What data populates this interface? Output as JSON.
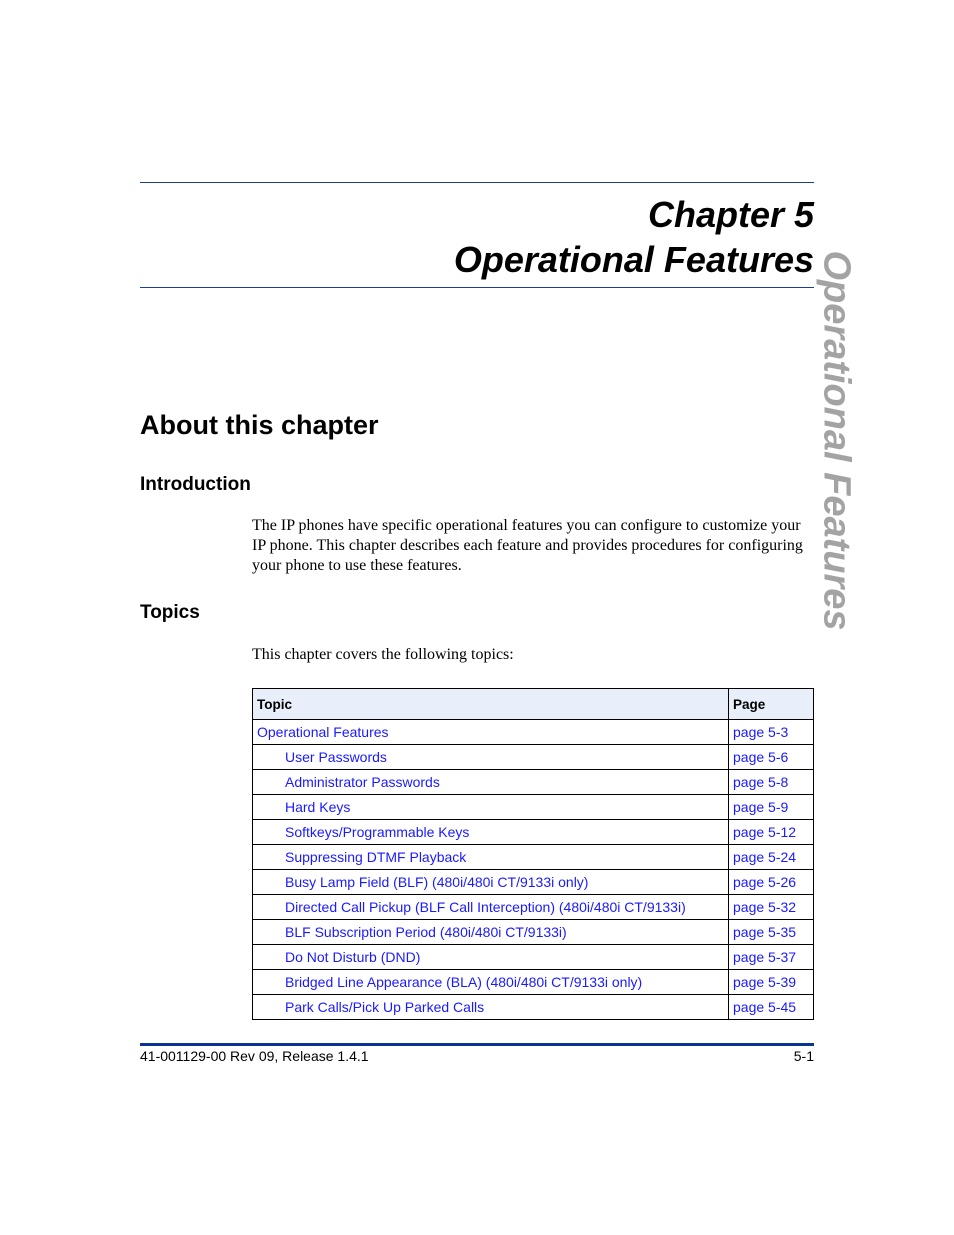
{
  "header": {
    "chapter_line": "Chapter 5",
    "title_line": "Operational Features",
    "side_tab": "Operational Features"
  },
  "section": {
    "heading": "About this chapter",
    "introduction": {
      "heading": "Introduction",
      "text": "The IP phones have specific operational features you can configure to customize your IP phone. This chapter describes each feature and provides procedures for configuring your phone to use these features."
    },
    "topics": {
      "heading": "Topics",
      "text": "This chapter covers the following topics:"
    }
  },
  "table": {
    "headers": {
      "topic": "Topic",
      "page": "Page"
    },
    "rows": [
      {
        "topic": "Operational Features",
        "page": "page 5-3",
        "indent": false
      },
      {
        "topic": "User Passwords",
        "page": "page 5-6",
        "indent": true
      },
      {
        "topic": "Administrator Passwords",
        "page": "page 5-8",
        "indent": true
      },
      {
        "topic": "Hard Keys",
        "page": "page 5-9",
        "indent": true
      },
      {
        "topic": "Softkeys/Programmable Keys",
        "page": "page 5-12",
        "indent": true
      },
      {
        "topic": "Suppressing DTMF Playback",
        "page": "page 5-24",
        "indent": true
      },
      {
        "topic": "Busy Lamp Field (BLF) (480i/480i CT/9133i only)",
        "page": "page 5-26",
        "indent": true
      },
      {
        "topic": "Directed Call Pickup (BLF Call Interception) (480i/480i CT/9133i)",
        "page": "page 5-32",
        "indent": true
      },
      {
        "topic": "BLF Subscription Period (480i/480i CT/9133i)",
        "page": "page 5-35",
        "indent": true
      },
      {
        "topic": "Do Not Disturb (DND)",
        "page": "page 5-37",
        "indent": true
      },
      {
        "topic": "Bridged Line Appearance (BLA) (480i/480i CT/9133i only)",
        "page": "page 5-39",
        "indent": true
      },
      {
        "topic": "Park Calls/Pick Up Parked Calls",
        "page": "page 5-45",
        "indent": true
      }
    ]
  },
  "footer": {
    "doc_id": "41-001129-00 Rev 09, Release 1.4.1",
    "page_number": "5-1"
  },
  "colors": {
    "rule": "#1a3f8f",
    "link": "#1a1aff",
    "table_header_bg": "#e8eefa",
    "side_tab": "#a3a3a3"
  }
}
